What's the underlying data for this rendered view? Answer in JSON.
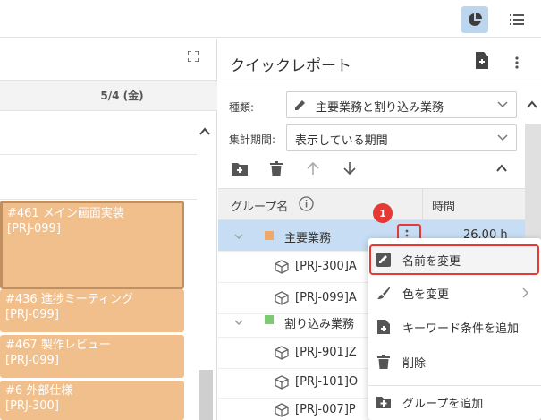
{
  "topbar": {
    "report_view_icon": "pie-chart-icon",
    "list_view_icon": "list-icon"
  },
  "calendar": {
    "date_header": "5/4 (金)",
    "events": [
      {
        "title": "#461 メイン画面実装",
        "project": "[PRJ-099]"
      },
      {
        "title": "#436 進捗ミーティング",
        "project": "[PRJ-099]"
      },
      {
        "title": "#467 製作レビュー",
        "project": "[PRJ-099]"
      },
      {
        "title": "#6 外部仕様",
        "project": "[PRJ-300]"
      }
    ],
    "event_color": "#f0bf8c"
  },
  "quick_report": {
    "title": "クイックレポート",
    "type_label": "種類:",
    "type_value": "主要業務と割り込み業務",
    "period_label": "集計期間:",
    "period_value": "表示している期間",
    "columns": {
      "group": "グループ名",
      "time": "時間"
    },
    "groups": [
      {
        "name": "主要業務",
        "color": "#f0a868",
        "time": "26.00 h",
        "children": [
          "[PRJ-300]A",
          "[PRJ-099]A"
        ]
      },
      {
        "name": "割り込み業務",
        "color": "#7ccb72",
        "children": [
          "[PRJ-901]Z",
          "[PRJ-101]O",
          "[PRJ-007]P"
        ]
      }
    ],
    "step_badge": "1"
  },
  "context_menu": {
    "items": [
      {
        "label": "名前を変更",
        "icon": "rename-icon"
      },
      {
        "label": "色を変更",
        "icon": "brush-icon"
      },
      {
        "label": "キーワード条件を追加",
        "icon": "add-keyword-icon"
      },
      {
        "label": "削除",
        "icon": "trash-icon"
      },
      {
        "label": "グループを追加",
        "icon": "add-folder-icon"
      }
    ]
  },
  "colors": {
    "highlight": "#e53935",
    "selected_row": "#c7ddf3",
    "toggle_active": "#bcd6ee"
  }
}
